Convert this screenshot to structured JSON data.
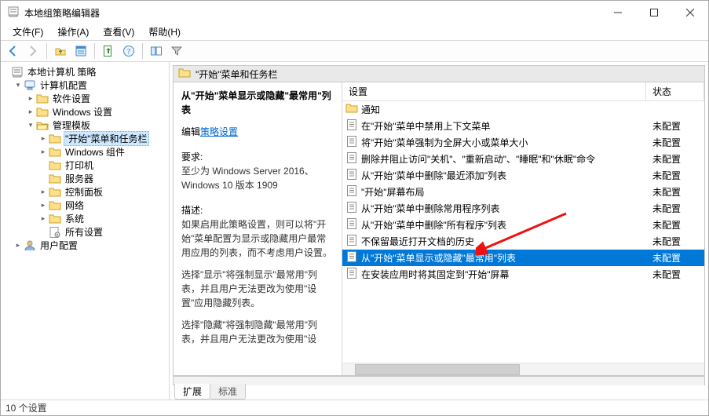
{
  "window": {
    "title": "本地组策略编辑器"
  },
  "menubar": {
    "file": "文件(F)",
    "action": "操作(A)",
    "view": "查看(V)",
    "help": "帮助(H)"
  },
  "tree": {
    "root": "本地计算机 策略",
    "computer_config": "计算机配置",
    "software_settings": "软件设置",
    "windows_settings": "Windows 设置",
    "admin_templates": "管理模板",
    "start_taskbar": "\"开始\"菜单和任务栏",
    "windows_components": "Windows 组件",
    "printers": "打印机",
    "server": "服务器",
    "control_panel": "控制面板",
    "network": "网络",
    "system": "系统",
    "all_settings": "所有设置",
    "user_config": "用户配置"
  },
  "content": {
    "breadcrumb": "\"开始\"菜单和任务栏"
  },
  "description": {
    "title": "从\"开始\"菜单显示或隐藏\"最常用\"列表",
    "edit_prefix": "编辑",
    "edit_link": "策略设置",
    "req_label": "要求:",
    "req_text": "至少为 Windows Server 2016、Windows 10 版本 1909",
    "desc_label": "描述:",
    "desc_para1": "如果启用此策略设置，则可以将\"开始\"菜单配置为显示或隐藏用户最常用应用的列表，而不考虑用户设置。",
    "desc_para2": "选择\"显示\"将强制显示\"最常用\"列表，并且用户无法更改为使用\"设置\"应用隐藏列表。",
    "desc_para3": "选择\"隐藏\"将强制隐藏\"最常用\"列表，并且用户无法更改为使用\"设"
  },
  "list": {
    "header_setting": "设置",
    "header_status": "状态",
    "folder_row": "通知",
    "rows": [
      {
        "label": "在\"开始\"菜单中禁用上下文菜单",
        "status": "未配置"
      },
      {
        "label": "将\"开始\"菜单强制为全屏大小或菜单大小",
        "status": "未配置"
      },
      {
        "label": "删除并阻止访问\"关机\"、\"重新启动\"、\"睡眠\"和\"休眠\"命令",
        "status": "未配置"
      },
      {
        "label": "从\"开始\"菜单中删除\"最近添加\"列表",
        "status": "未配置"
      },
      {
        "label": "\"开始\"屏幕布局",
        "status": "未配置"
      },
      {
        "label": "从\"开始\"菜单中删除常用程序列表",
        "status": "未配置"
      },
      {
        "label": "从\"开始\"菜单中删除\"所有程序\"列表",
        "status": "未配置"
      },
      {
        "label": "不保留最近打开文档的历史",
        "status": "未配置"
      },
      {
        "label": "从\"开始\"菜单显示或隐藏\"最常用\"列表",
        "status": "未配置",
        "selected": true
      },
      {
        "label": "在安装应用时将其固定到\"开始\"屏幕",
        "status": "未配置"
      }
    ]
  },
  "tabs": {
    "extended": "扩展",
    "standard": "标准"
  },
  "statusbar": {
    "text": "10 个设置"
  }
}
